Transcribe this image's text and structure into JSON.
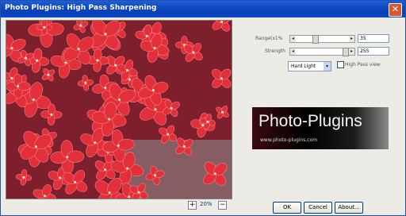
{
  "window": {
    "title": "Photo Plugins: High Pass Sharpening",
    "close_glyph": "✕"
  },
  "controls": {
    "range": {
      "label": "Range(x1%",
      "value": "35",
      "level": 0.35
    },
    "strength": {
      "label": "Strength",
      "value": "255",
      "level": 1.0
    },
    "blend_mode": {
      "value": "Hard Light"
    },
    "high_pass_view": {
      "label": "High Pass view",
      "checked": false
    }
  },
  "zoom": {
    "value": "20%"
  },
  "logo": {
    "title": "Photo-Plugins",
    "url": "www.photo-plugins.com"
  },
  "buttons": {
    "ok": "OK",
    "cancel": "Cancel",
    "about": "About..."
  },
  "colors": {
    "titlebar": "#0a3fb8",
    "petal": "#e2303a",
    "preview_bg": "#7d1f2c"
  }
}
